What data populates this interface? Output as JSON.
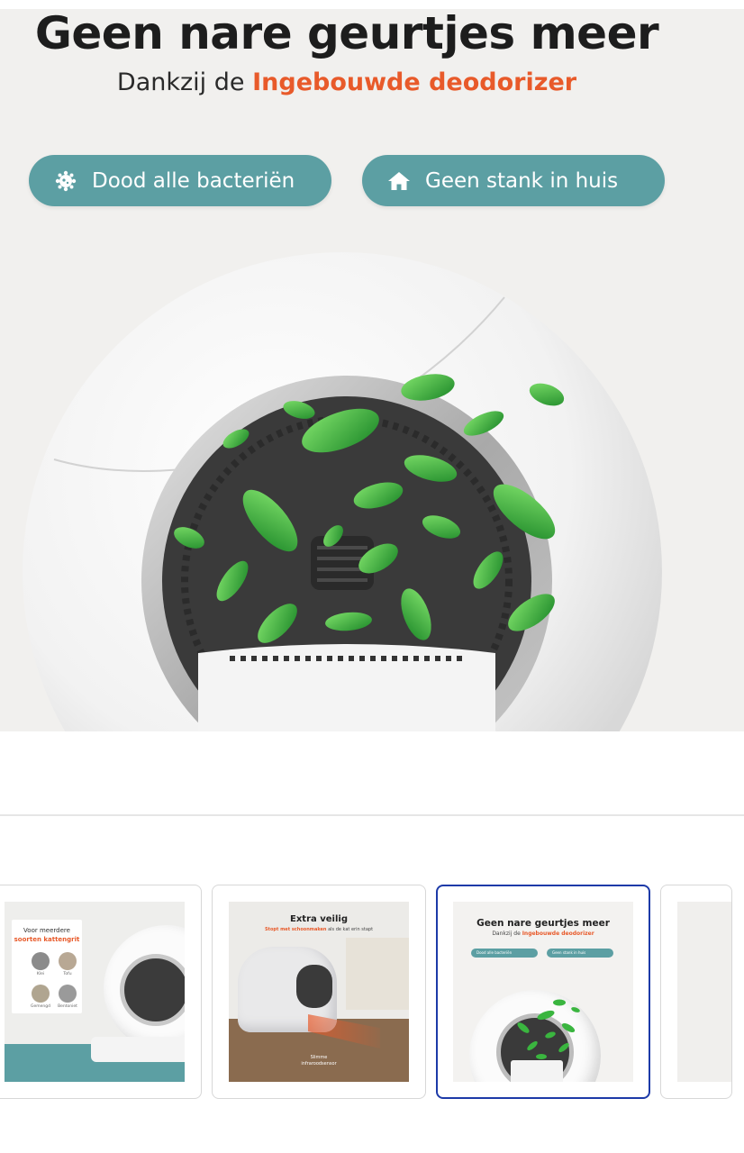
{
  "hero": {
    "title": "Geen nare geurtjes meer",
    "subtitle_prefix": "Dankzij de ",
    "subtitle_accent": "Ingebouwde deodorizer",
    "accent_color": "#e85a2a",
    "pill_color": "#5c9fa3",
    "pills": [
      {
        "label": "Dood alle bacteriën",
        "icon": "bacteria-icon"
      },
      {
        "label": "Geen stank in huis",
        "icon": "home-icon"
      }
    ]
  },
  "thumbnails": {
    "active_index": 2,
    "active_border_color": "#1d3aa8",
    "items": [
      {
        "heading_line1": "Voor meerdere",
        "heading_line2": "soorten kattengrit",
        "litter_types": [
          "Klei",
          "Tofu",
          "Gemengd",
          "Bentoniet"
        ],
        "litter_sub": [
          "cutting",
          "kateen",
          "kateen",
          "kateen"
        ]
      },
      {
        "title": "Extra veilig",
        "subtitle_accent": "Stopt met schoonmaken",
        "subtitle_rest": " als de kat erin stapt",
        "caption_line1": "Slimme",
        "caption_line2": "infraroodsensor"
      },
      {
        "title": "Geen nare geurtjes meer",
        "subtitle_prefix": "Dankzij de ",
        "subtitle_accent": "Ingebouwde deodorizer",
        "pills": [
          "Dood alle bacteriën",
          "Geen stank in huis"
        ]
      },
      {}
    ]
  }
}
